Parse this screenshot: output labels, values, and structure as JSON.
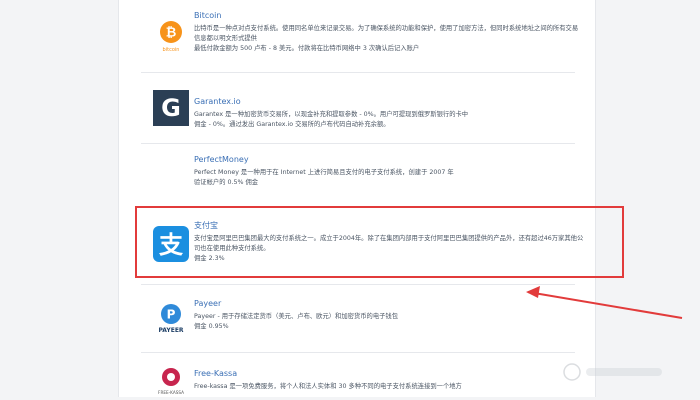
{
  "payments": [
    {
      "name": "Bitcoin",
      "description": "比特币是一种点对点支付系统。使用同名单位来记录交易。为了确保系统的功能和保护，使用了加密方法，但同时系统地址之间的所有交易信息都以明文形式提供",
      "fee": "最低付款金额为 500 卢布 - 8 美元。付款将在比特币网络中 3 次确认后记入账户",
      "logo_icon": "bitcoin-logo",
      "logo_text": "bitcoin",
      "accent": "#f7931a"
    },
    {
      "name": "Garantex.io",
      "description": "Garantex 是一种加密货币交易所，以现金补充和提取参数 - 0%。用户可提现到俄罗斯银行的卡中",
      "fee": "佣金 - 0%。通过发出 Garantex.io 交易所的卢布代码自动补充余额。",
      "logo_icon": "garantex-logo",
      "logo_text": "G",
      "accent": "#2b3f55"
    },
    {
      "name": "PerfectMoney",
      "description": "Perfect Money 是一种用于在 Internet 上进行简易且支付的电子支付系统，创建于 2007 年",
      "fee": "验证帐户的 0.5% 佣金",
      "logo_icon": "perfectmoney-logo"
    },
    {
      "name": "支付宝",
      "description": "支付宝是阿里巴巴集团最大的支付系统之一。成立于2004年。除了在集团内部用于支付阿里巴巴集团提供的产品外，还有超过46万家其他公司也在使用此种支付系统。",
      "fee": "佣金 2.3%",
      "logo_icon": "alipay-logo",
      "logo_text": "支",
      "accent": "#1b8fe0"
    },
    {
      "name": "Payeer",
      "description": "Payeer - 用于存储法定货币（美元、卢布、欧元）和加密货币的电子钱包",
      "fee": "佣金 0.95%",
      "logo_icon": "payeer-logo",
      "logo_text": "PAYEER",
      "accent": "#2f8ad9"
    },
    {
      "name": "Free-Kassa",
      "description": "Free-kassa 是一项免费服务，将个人和法人实体和 30 多种不同的电子支付系统连接到一个地方",
      "logo_icon": "freekassa-logo",
      "logo_text": "FREE-KASSA",
      "accent": "#c7254e"
    }
  ],
  "annotation": {
    "box_color": "#e23b3b",
    "arrow_color": "#e23b3b",
    "arrow_icon": "red-arrow-icon"
  },
  "watermark": {
    "icon": "watermark-logo-icon"
  }
}
